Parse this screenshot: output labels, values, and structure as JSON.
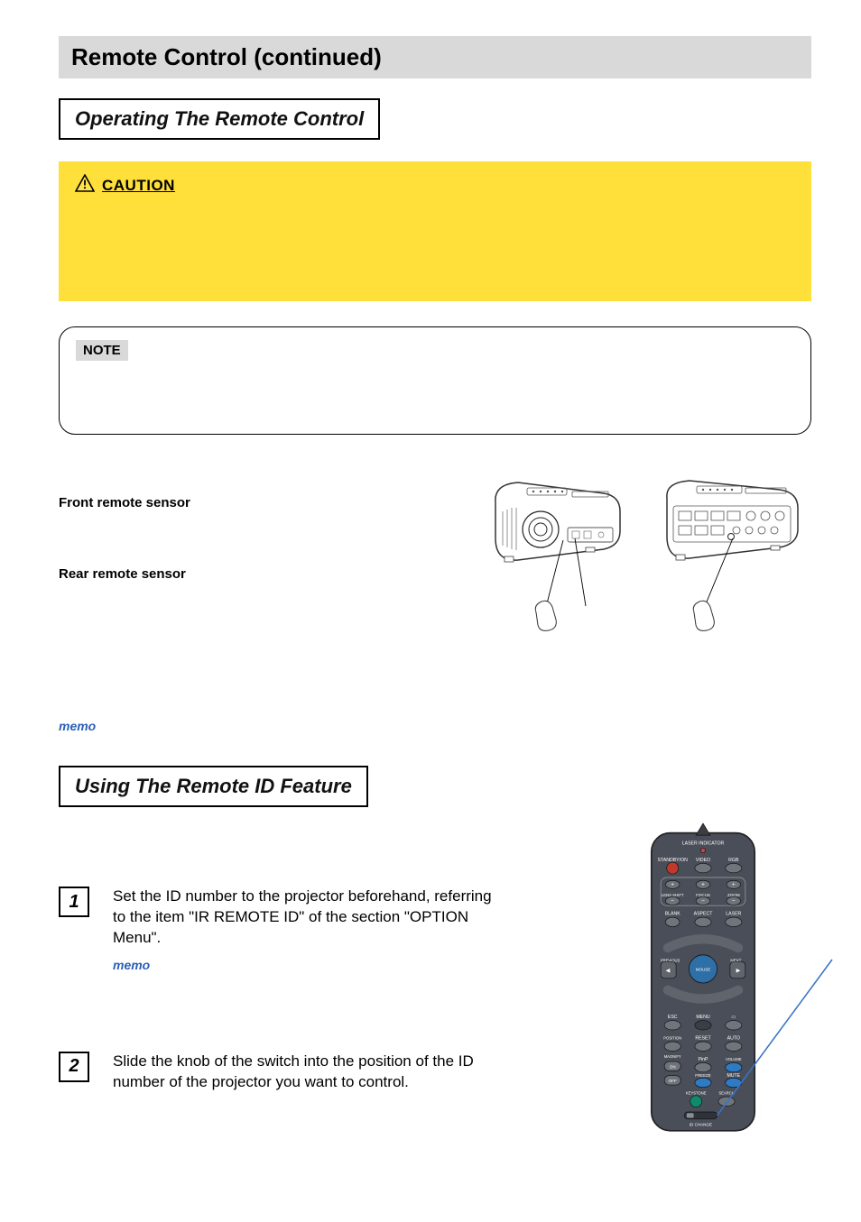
{
  "title": "Remote Control (continued)",
  "section1": {
    "heading": "Operating The Remote Control"
  },
  "caution": {
    "label": "CAUTION"
  },
  "note": {
    "label": "NOTE"
  },
  "sensors": {
    "front": "Front remote sensor",
    "rear": "Rear remote sensor"
  },
  "memo1": "memo",
  "section2": {
    "heading": "Using The Remote ID Feature"
  },
  "steps": {
    "1": {
      "num": "1",
      "text": "Set the ID number to the projector beforehand, referring to the item \"IR REMOTE ID\" of the section \"OPTION Menu\".",
      "memo": "memo"
    },
    "2": {
      "num": "2",
      "text": "Slide the knob of the switch into the position of the ID number of the projector you want to control."
    }
  },
  "remote": {
    "top_label": "LASER INDICATOR",
    "row1": {
      "standby": "STANDBY/ON",
      "video": "VIDEO",
      "rgb": "RGB"
    },
    "row2": {
      "lens": "LENS SHIFT",
      "focus": "FOCUS",
      "zoom": "ZOOM"
    },
    "row3": {
      "blank": "BLANK",
      "aspect": "ASPECT",
      "laser": "LASER"
    },
    "nav": {
      "previous": "PREVIOUS",
      "next": "NEXT",
      "mouse": "MOUSE"
    },
    "row4": {
      "esc": "ESC",
      "menu": "MENU"
    },
    "row5": {
      "position": "POSITION",
      "reset": "RESET",
      "auto": "AUTO"
    },
    "row6": {
      "magnify": "MAGNIFY",
      "on": "ON",
      "pinp": "PinP",
      "volume": "VOLUME"
    },
    "row7": {
      "off": "OFF",
      "freeze": "FREEZE",
      "mute": "MUTE"
    },
    "row8": {
      "keystone": "KEYSTONE",
      "search": "SEARCH"
    },
    "bottom": {
      "id_change": "ID CHANGE"
    }
  }
}
